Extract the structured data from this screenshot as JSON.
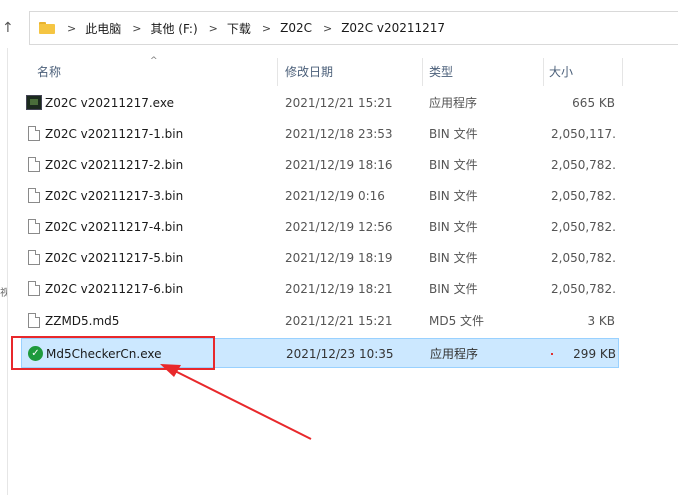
{
  "nav": {
    "up_glyph": "↑",
    "edge_glyph": "视"
  },
  "breadcrumb": {
    "items": [
      "此电脑",
      "其他 (F:)",
      "下载",
      "Z02C",
      "Z02C v20211217"
    ],
    "separator": ">"
  },
  "columns": {
    "name": "名称",
    "date": "修改日期",
    "type": "类型",
    "size": "大小",
    "sort_indicator": "^"
  },
  "files": [
    {
      "name": "Z02C v20211217.exe",
      "date": "2021/12/21 15:21",
      "type": "应用程序",
      "size": "665 KB",
      "icon": "exe-icon"
    },
    {
      "name": "Z02C v20211217-1.bin",
      "date": "2021/12/18 23:53",
      "type": "BIN 文件",
      "size": "2,050,117...",
      "icon": "document-icon"
    },
    {
      "name": "Z02C v20211217-2.bin",
      "date": "2021/12/19 18:16",
      "type": "BIN 文件",
      "size": "2,050,782...",
      "icon": "document-icon"
    },
    {
      "name": "Z02C v20211217-3.bin",
      "date": "2021/12/19 0:16",
      "type": "BIN 文件",
      "size": "2,050,782...",
      "icon": "document-icon"
    },
    {
      "name": "Z02C v20211217-4.bin",
      "date": "2021/12/19 12:56",
      "type": "BIN 文件",
      "size": "2,050,782...",
      "icon": "document-icon"
    },
    {
      "name": "Z02C v20211217-5.bin",
      "date": "2021/12/19 18:19",
      "type": "BIN 文件",
      "size": "2,050,782...",
      "icon": "document-icon"
    },
    {
      "name": "Z02C v20211217-6.bin",
      "date": "2021/12/19 18:21",
      "type": "BIN 文件",
      "size": "2,050,782...",
      "icon": "document-icon"
    },
    {
      "name": "ZZMD5.md5",
      "date": "2021/12/21 15:21",
      "type": "MD5 文件",
      "size": "3 KB",
      "icon": "document-icon"
    },
    {
      "name": "Md5CheckerCn.exe",
      "date": "2021/12/23 10:35",
      "type": "应用程序",
      "size": "299 KB",
      "icon": "green-check-icon",
      "selected": true
    }
  ],
  "colors": {
    "selection_bg": "#cce8ff",
    "selection_border": "#99d1ff",
    "annotation_red": "#e8282b",
    "header_text": "#4c607a",
    "folder_yellow": "#f5c542"
  }
}
